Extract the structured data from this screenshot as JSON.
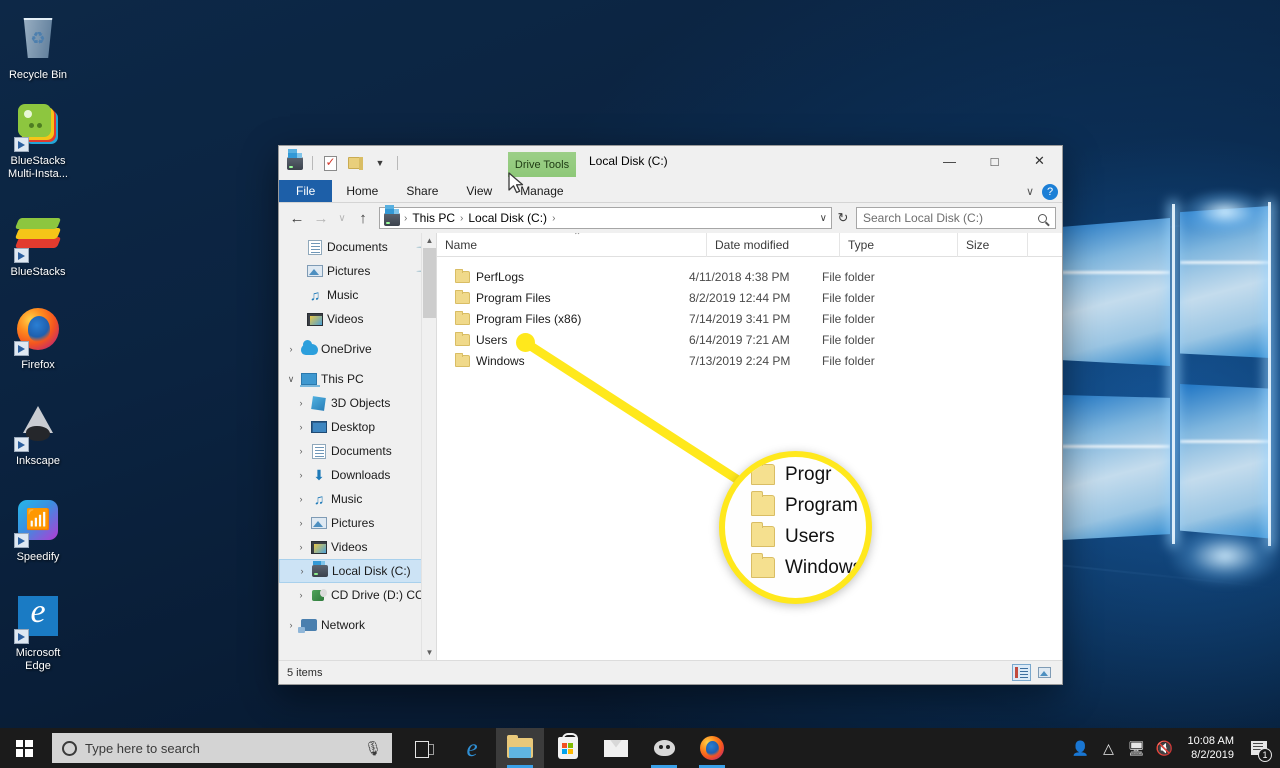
{
  "desktop": {
    "icons": [
      {
        "label": "Recycle Bin",
        "icon": "recycle-bin-icon",
        "shortcut": false
      },
      {
        "label": "BlueStacks Multi-Insta...",
        "icon": "bluestacks-multi-instance-icon",
        "shortcut": true
      },
      {
        "label": "BlueStacks",
        "icon": "bluestacks-icon",
        "shortcut": true
      },
      {
        "label": "Firefox",
        "icon": "firefox-icon",
        "shortcut": true
      },
      {
        "label": "Inkscape",
        "icon": "inkscape-icon",
        "shortcut": true
      },
      {
        "label": "Speedify",
        "icon": "speedify-icon",
        "shortcut": true
      },
      {
        "label": "Microsoft Edge",
        "icon": "microsoft-edge-icon",
        "shortcut": true
      }
    ]
  },
  "explorer": {
    "title": "Local Disk (C:)",
    "contextual_tab_group": "Drive Tools",
    "quick_access": [
      {
        "name": "drive-icon",
        "label": "Local Disk (C:)"
      },
      {
        "name": "properties-icon",
        "label": "Properties"
      },
      {
        "name": "new-folder-icon",
        "label": "New folder"
      },
      {
        "name": "customize-qat-chevron-icon",
        "label": "Customize Quick Access Toolbar"
      }
    ],
    "window_controls": {
      "minimize": "—",
      "maximize": "□",
      "close": "✕",
      "collapse_ribbon": "∨",
      "help": "?"
    },
    "ribbon_tabs": [
      {
        "label": "File",
        "active": true
      },
      {
        "label": "Home",
        "active": false
      },
      {
        "label": "Share",
        "active": false
      },
      {
        "label": "View",
        "active": false
      },
      {
        "label": "Manage",
        "active": false
      }
    ],
    "address_bar": {
      "back": "←",
      "forward": "→",
      "recent": "∨",
      "up": "↑",
      "breadcrumbs": [
        "This PC",
        "Local Disk (C:)"
      ],
      "separator": "›",
      "dropdown": "∨",
      "refresh": "↻"
    },
    "search": {
      "placeholder": "Search Local Disk (C:)",
      "value": ""
    },
    "nav_pane": {
      "items": [
        {
          "label": "Documents",
          "icon": "documents-icon",
          "indent": 2,
          "expander": "",
          "pinned": true,
          "selected": false
        },
        {
          "label": "Pictures",
          "icon": "pictures-icon",
          "indent": 2,
          "expander": "",
          "pinned": true,
          "selected": false
        },
        {
          "label": "Music",
          "icon": "music-icon",
          "indent": 2,
          "expander": "",
          "pinned": false,
          "selected": false
        },
        {
          "label": "Videos",
          "icon": "videos-icon",
          "indent": 2,
          "expander": "",
          "pinned": false,
          "selected": false
        },
        {
          "label": "OneDrive",
          "icon": "onedrive-icon",
          "indent": 0,
          "expander": "›",
          "pinned": false,
          "selected": false
        },
        {
          "label": "This PC",
          "icon": "this-pc-icon",
          "indent": 0,
          "expander": "∨",
          "pinned": false,
          "selected": false
        },
        {
          "label": "3D Objects",
          "icon": "3d-objects-icon",
          "indent": 1,
          "expander": "›",
          "pinned": false,
          "selected": false
        },
        {
          "label": "Desktop",
          "icon": "desktop-icon",
          "indent": 1,
          "expander": "›",
          "pinned": false,
          "selected": false
        },
        {
          "label": "Documents",
          "icon": "documents-icon",
          "indent": 1,
          "expander": "›",
          "pinned": false,
          "selected": false
        },
        {
          "label": "Downloads",
          "icon": "downloads-icon",
          "indent": 1,
          "expander": "›",
          "pinned": false,
          "selected": false
        },
        {
          "label": "Music",
          "icon": "music-icon",
          "indent": 1,
          "expander": "›",
          "pinned": false,
          "selected": false
        },
        {
          "label": "Pictures",
          "icon": "pictures-icon",
          "indent": 1,
          "expander": "›",
          "pinned": false,
          "selected": false
        },
        {
          "label": "Videos",
          "icon": "videos-icon",
          "indent": 1,
          "expander": "›",
          "pinned": false,
          "selected": false
        },
        {
          "label": "Local Disk (C:)",
          "icon": "local-disk-icon",
          "indent": 1,
          "expander": "›",
          "pinned": false,
          "selected": true
        },
        {
          "label": "CD Drive (D:) CC",
          "icon": "cd-drive-icon",
          "indent": 1,
          "expander": "›",
          "pinned": false,
          "selected": false
        },
        {
          "label": "Network",
          "icon": "network-icon",
          "indent": 0,
          "expander": "›",
          "pinned": false,
          "selected": false
        }
      ]
    },
    "file_list": {
      "columns": [
        "Name",
        "Date modified",
        "Type",
        "Size"
      ],
      "sort_column": "Name",
      "sort_caret": "⌃",
      "rows": [
        {
          "name": "PerfLogs",
          "date": "4/11/2018 4:38 PM",
          "type": "File folder",
          "size": ""
        },
        {
          "name": "Program Files",
          "date": "8/2/2019 12:44 PM",
          "type": "File folder",
          "size": ""
        },
        {
          "name": "Program Files (x86)",
          "date": "7/14/2019 3:41 PM",
          "type": "File folder",
          "size": ""
        },
        {
          "name": "Users",
          "date": "6/14/2019 7:21 AM",
          "type": "File folder",
          "size": ""
        },
        {
          "name": "Windows",
          "date": "7/13/2019 2:24 PM",
          "type": "File folder",
          "size": ""
        }
      ]
    },
    "status_bar": {
      "item_count": "5 items",
      "view_buttons": [
        {
          "name": "details-view-button",
          "active": true
        },
        {
          "name": "thumbnail-view-button",
          "active": false
        }
      ]
    }
  },
  "callout": {
    "accent_color": "#ffe81c",
    "magnified_rows": [
      "Progr",
      "Program",
      "Users",
      "Windows"
    ]
  },
  "taskbar": {
    "start": "start-button",
    "search_placeholder": "Type here to search",
    "icons": [
      {
        "name": "task-view-icon",
        "label": "Task View",
        "state": "idle"
      },
      {
        "name": "microsoft-edge-icon",
        "label": "Microsoft Edge",
        "state": "idle"
      },
      {
        "name": "file-explorer-icon",
        "label": "File Explorer",
        "state": "active"
      },
      {
        "name": "microsoft-store-icon",
        "label": "Microsoft Store",
        "state": "idle"
      },
      {
        "name": "mail-icon",
        "label": "Mail",
        "state": "idle"
      },
      {
        "name": "gimp-icon",
        "label": "GIMP",
        "state": "running"
      },
      {
        "name": "firefox-icon",
        "label": "Firefox",
        "state": "running"
      }
    ],
    "tray": [
      {
        "name": "people-icon",
        "glyph": "Ὀ1"
      },
      {
        "name": "show-hidden-icons-chevron",
        "glyph": "∧"
      },
      {
        "name": "network-icon",
        "glyph": "὚5"
      },
      {
        "name": "volume-muted-icon",
        "glyph": "ὐ7"
      }
    ],
    "clock": {
      "time": "10:08 AM",
      "date": "8/2/2019"
    },
    "notification_count": "1"
  }
}
